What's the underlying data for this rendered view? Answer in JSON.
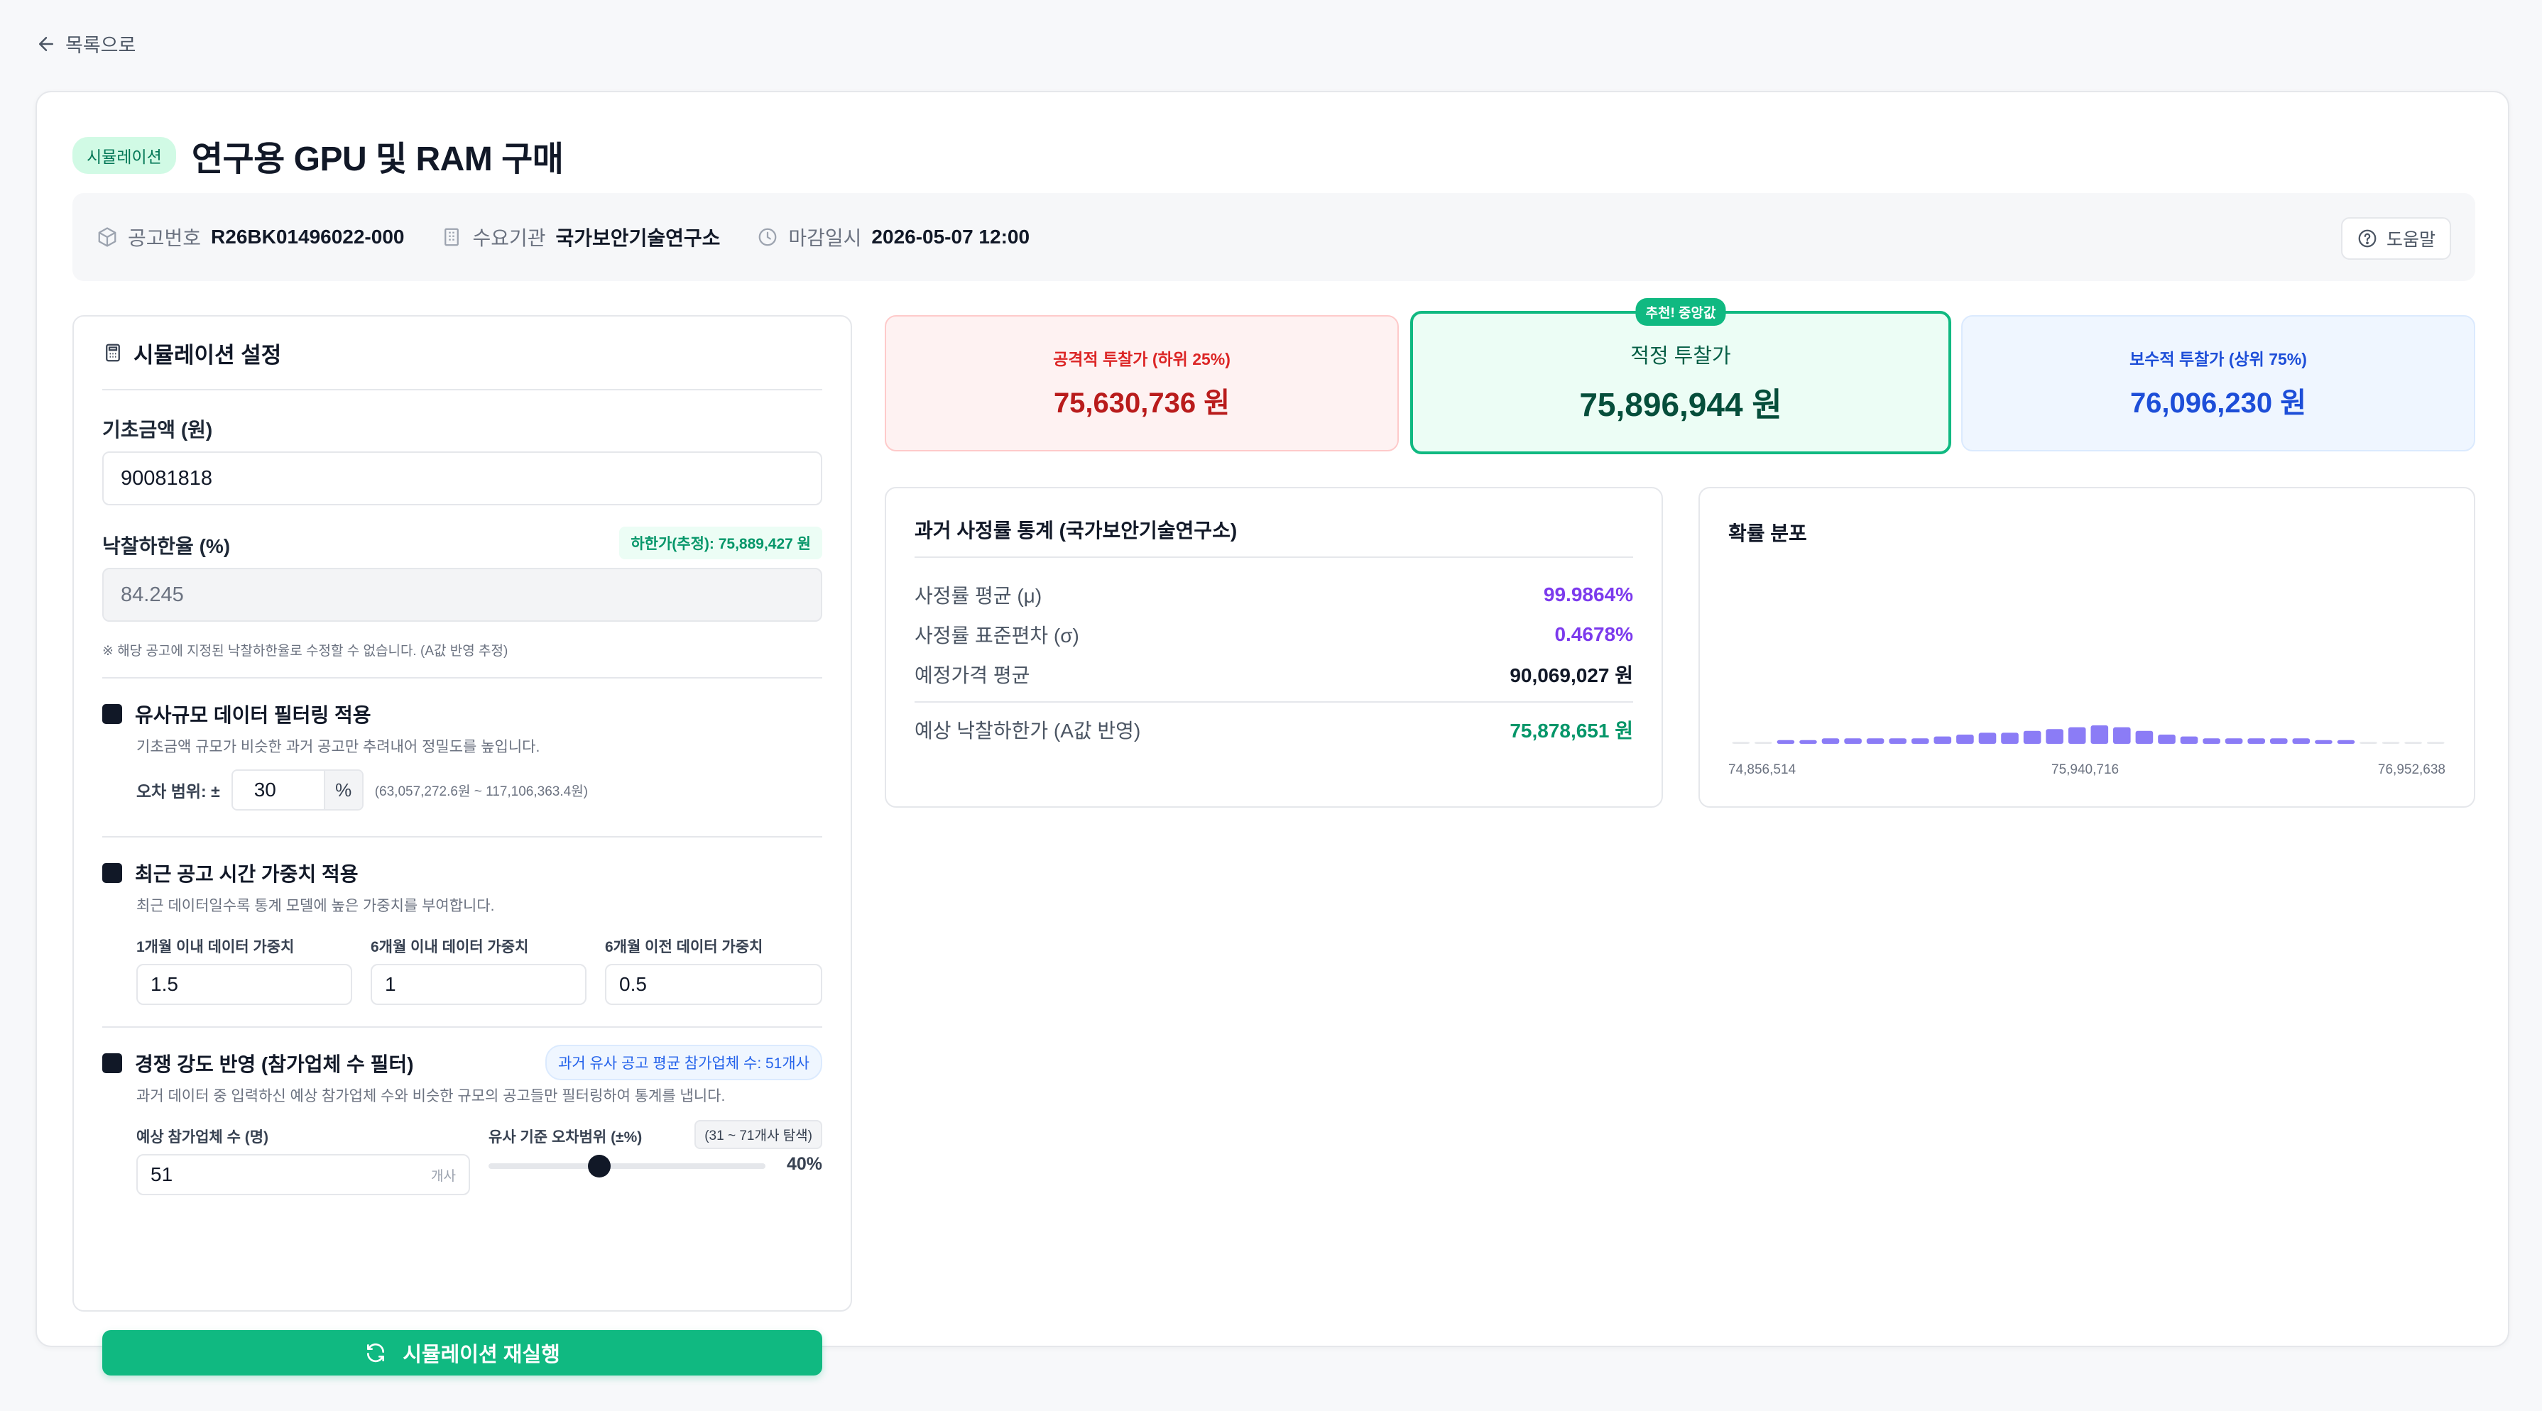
{
  "nav": {
    "back_label": "목록으로"
  },
  "header": {
    "badge": "시뮬레이션",
    "title": "연구용 GPU 및 RAM 구매",
    "notice_no_label": "공고번호",
    "notice_no": "R26BK01496022-000",
    "agency_label": "수요기관",
    "agency": "국가보안기술연구소",
    "deadline_label": "마감일시",
    "deadline": "2026-05-07 12:00",
    "help_label": "도움말"
  },
  "settings": {
    "title": "시뮬레이션 설정",
    "base_amount_label": "기초금액 (원)",
    "base_amount_value": "90081818",
    "lower_rate_label": "낙찰하한율 (%)",
    "lower_limit_chip": "하한가(추정): 75,889,427 원",
    "lower_rate_value": "84.245",
    "lower_rate_note": "※ 해당 공고에 지정된 낙찰하한율로 수정할 수 없습니다. (A값 반영 추정)",
    "filter_size": {
      "label": "유사규모 데이터 필터링 적용",
      "desc": "기초금액 규모가 비슷한 과거 공고만 추려내어 정밀도를 높입니다.",
      "range_label": "오차 범위: ±",
      "range_value": "30",
      "range_unit": "%",
      "range_hint": "(63,057,272.6원 ~ 117,106,363.4원)"
    },
    "time_weight": {
      "label": "최근 공고 시간 가중치 적용",
      "desc": "최근 데이터일수록 통계 모델에 높은 가중치를 부여합니다.",
      "w1_label": "1개월 이내 데이터 가중치",
      "w1_value": "1.5",
      "w2_label": "6개월 이내 데이터 가중치",
      "w2_value": "1",
      "w3_label": "6개월 이전 데이터 가중치",
      "w3_value": "0.5"
    },
    "competition": {
      "label": "경쟁 강도 반영 (참가업체 수 필터)",
      "chip": "과거 유사 공고 평균 참가업체 수: 51개사",
      "desc": "과거 데이터 중 입력하신 예상 참가업체 수와 비슷한 규모의 공고들만 필터링하여 통계를 냅니다.",
      "count_label": "예상 참가업체 수 (명)",
      "count_value": "51",
      "count_unit": "개사",
      "range_label": "유사 기준 오차범위 (±%)",
      "range_chip": "(31 ~ 71개사 탐색)",
      "slider_value": 0.4,
      "slider_text": "40%"
    },
    "run_label": "시뮬레이션 재실행"
  },
  "prices": {
    "aggressive_label": "공격적 투찰가 (하위 25%)",
    "aggressive_value": "75,630,736 원",
    "optimal_badge": "추천! 중앙값",
    "optimal_label": "적정 투찰가",
    "optimal_value": "75,896,944 원",
    "conservative_label": "보수적 투찰가 (상위 75%)",
    "conservative_value": "76,096,230 원"
  },
  "stats": {
    "title": "과거 사정률 통계 (국가보안기술연구소)",
    "mean_label": "사정률 평균 (μ)",
    "mean_value": "99.9864%",
    "std_label": "사정률 표준편차 (σ)",
    "std_value": "0.4678%",
    "price_avg_label": "예정가격 평균",
    "price_avg_value": "90,069,027 원",
    "expected_label": "예상 낙찰하한가 (A값 반영)",
    "expected_value": "75,878,651 원"
  },
  "distribution": {
    "title": "확률 분포",
    "x_min_label": "74,856,514",
    "x_mid_label": "75,940,716",
    "x_max_label": "76,952,638",
    "bar_color": "#8b7cf6",
    "values": [
      1,
      1,
      2,
      2,
      3,
      3,
      3,
      3,
      3,
      4,
      5,
      6,
      6,
      7,
      8,
      9,
      10,
      9,
      7,
      5,
      4,
      3,
      3,
      3,
      3,
      3,
      2,
      2,
      1,
      1,
      1,
      1
    ]
  }
}
